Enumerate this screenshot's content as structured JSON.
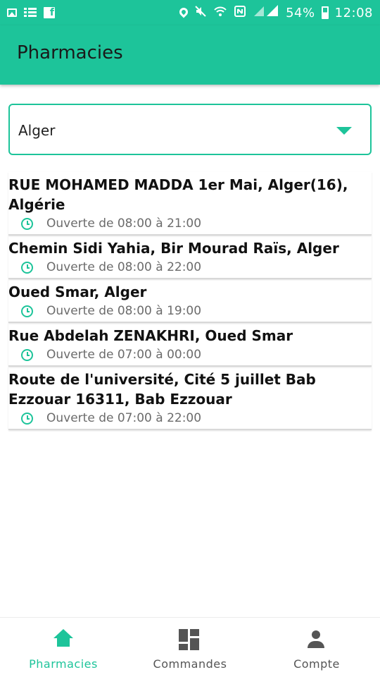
{
  "status_bar": {
    "battery": "54%",
    "time": "12:08",
    "icons": [
      "image-icon",
      "list-icon",
      "facebook-icon",
      "location-icon",
      "mute-icon",
      "wifi-icon",
      "nfc-icon",
      "signal-icon",
      "battery-icon"
    ]
  },
  "app_bar": {
    "title": "Pharmacies"
  },
  "dropdown": {
    "selected": "Alger"
  },
  "pharmacies": [
    {
      "address": "RUE MOHAMED MADDA 1er Mai, Alger(16), Algérie",
      "hours": "Ouverte de 08:00 à 21:00"
    },
    {
      "address": "Chemin Sidi Yahia, Bir Mourad Raïs, Alger",
      "hours": "Ouverte de 08:00 à 22:00"
    },
    {
      "address": "Oued Smar, Alger",
      "hours": "Ouverte de 08:00 à 19:00"
    },
    {
      "address": "Rue Abdelah ZENAKHRI, Oued Smar",
      "hours": "Ouverte de 07:00 à 00:00"
    },
    {
      "address": "Route de l'université, Cité 5 juillet Bab Ezzouar 16311, Bab Ezzouar",
      "hours": "Ouverte de 07:00 à 22:00"
    }
  ],
  "bottom_nav": {
    "items": [
      {
        "label": "Pharmacies",
        "icon": "home-icon",
        "active": true
      },
      {
        "label": "Commandes",
        "icon": "dashboard-icon",
        "active": false
      },
      {
        "label": "Compte",
        "icon": "person-icon",
        "active": false
      }
    ]
  },
  "colors": {
    "accent": "#1dc49a",
    "text": "#111111",
    "muted": "#6b6b6b"
  }
}
